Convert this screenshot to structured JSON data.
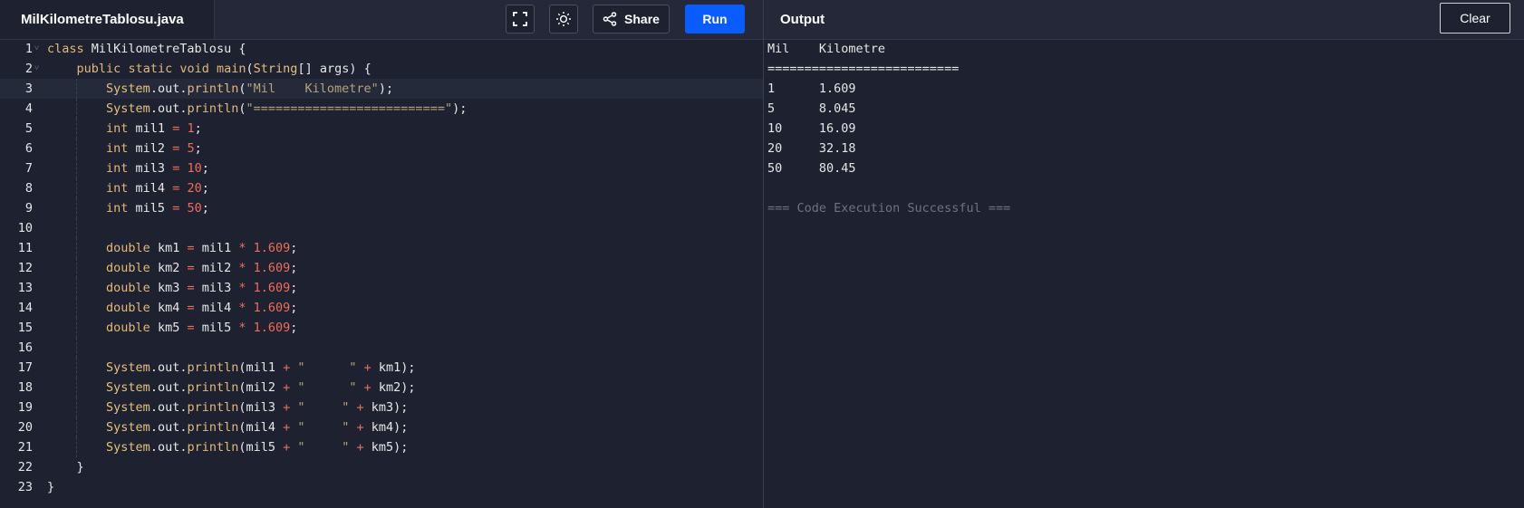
{
  "editor": {
    "file_name": "MilKilometreTablosu.java",
    "share_label": "Share",
    "run_label": "Run",
    "line_numbers": [
      "1",
      "2",
      "3",
      "4",
      "5",
      "6",
      "7",
      "8",
      "9",
      "10",
      "11",
      "12",
      "13",
      "14",
      "15",
      "16",
      "17",
      "18",
      "19",
      "20",
      "21",
      "22",
      "23"
    ],
    "code_lines": [
      "class MilKilometreTablosu {",
      "    public static void main(String[] args) {",
      "        System.out.println(\"Mil    Kilometre\");",
      "        System.out.println(\"==========================\");",
      "        int mil1 = 1;",
      "        int mil2 = 5;",
      "        int mil3 = 10;",
      "        int mil4 = 20;",
      "        int mil5 = 50;",
      "",
      "        double km1 = mil1 * 1.609;",
      "        double km2 = mil2 * 1.609;",
      "        double km3 = mil3 * 1.609;",
      "        double km4 = mil4 * 1.609;",
      "        double km5 = mil5 * 1.609;",
      "",
      "        System.out.println(mil1 + \"      \" + km1);",
      "        System.out.println(mil2 + \"      \" + km2);",
      "        System.out.println(mil3 + \"     \" + km3);",
      "        System.out.println(mil4 + \"     \" + km4);",
      "        System.out.println(mil5 + \"     \" + km5);",
      "    }",
      "}"
    ],
    "active_line": 3
  },
  "output": {
    "title": "Output",
    "clear_label": "Clear",
    "lines": [
      "Mil    Kilometre",
      "==========================",
      "1      1.609",
      "5      8.045",
      "10     16.09",
      "20     32.18",
      "50     80.45",
      "",
      "=== Code Execution Successful ==="
    ]
  },
  "icons": {
    "fullscreen": "fullscreen-icon",
    "theme": "sun-icon",
    "share": "share-icon"
  },
  "colors": {
    "accent": "#0a5cff",
    "background": "#1d2130",
    "header": "#242838"
  }
}
